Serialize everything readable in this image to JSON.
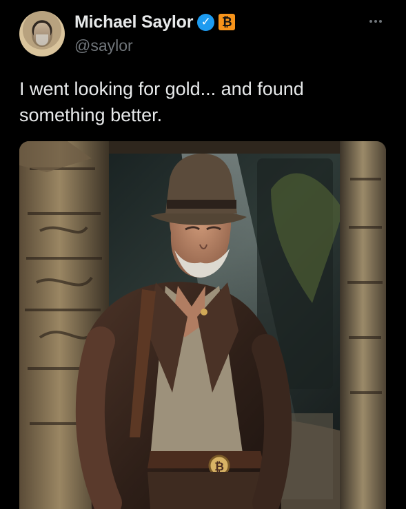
{
  "post": {
    "author": {
      "name": "Michael Saylor",
      "handle": "@saylor",
      "verified_icon": "verified-check-icon",
      "badge": {
        "text": "₿",
        "color": "#f7931a"
      }
    },
    "text": "I went looking for gold... and found\nsomething better.",
    "more_icon": "more-options-icon",
    "image_icon": "photo-icon",
    "image_badge_text": "₿"
  },
  "theme": {
    "background": "#000000",
    "text": "#e7e9ea",
    "secondary": "#71767b",
    "verified": "#1d9bf0"
  }
}
